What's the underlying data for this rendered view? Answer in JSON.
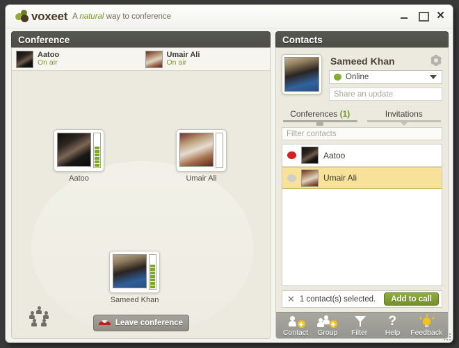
{
  "window": {
    "logo_wordmark": "voxeet",
    "tagline_pre": "A ",
    "tagline_em": "natural",
    "tagline_post": " way to conference",
    "controls": {
      "minimize": "minimize-button",
      "maximize": "maximize-button",
      "close": "✕"
    }
  },
  "conference": {
    "title": "Conference",
    "onair": [
      {
        "name": "Aatoo",
        "status": "On air"
      },
      {
        "name": "Umair Ali",
        "status": "On air"
      }
    ],
    "participants": [
      {
        "name": "Aatoo",
        "vu_bars": 6
      },
      {
        "name": "Umair Ali",
        "vu_bars": 0
      },
      {
        "name": "Sameed Khan",
        "vu_bars": 7
      }
    ],
    "leave_label": "Leave conference",
    "group_icon": "group-people-icon"
  },
  "contacts": {
    "title": "Contacts",
    "profile": {
      "name": "Sameed Khan",
      "status_value": "Online",
      "status_color": "#85ac2c",
      "update_placeholder": "Share an update",
      "settings_icon": "gear-icon"
    },
    "tabs": [
      {
        "label": "Conferences",
        "count": "(1)",
        "active": true
      },
      {
        "label": "Invitations",
        "count": "",
        "active": false
      }
    ],
    "filter_placeholder": "Filter contacts",
    "list": [
      {
        "name": "Aatoo",
        "presence": "busy",
        "presence_color": "#d81e1e",
        "selected": false
      },
      {
        "name": "Umair Ali",
        "presence": "offline",
        "presence_color": "#cfcfc7",
        "selected": true
      }
    ],
    "selection": {
      "clear_icon": "✕",
      "text": "1 contact(s) selected.",
      "add_label": "Add to call"
    },
    "toolbar": [
      {
        "label": "Contact",
        "icon": "add-contact-icon"
      },
      {
        "label": "Group",
        "icon": "add-group-icon"
      },
      {
        "label": "Filter",
        "icon": "funnel-icon"
      },
      {
        "label": "Help",
        "icon": "question-icon"
      },
      {
        "label": "Feedback",
        "icon": "lightbulb-icon"
      }
    ]
  },
  "accent": {
    "green": "#7c9a2e",
    "selected_row": "#f8e198",
    "panel_header": "#4e4e48"
  }
}
